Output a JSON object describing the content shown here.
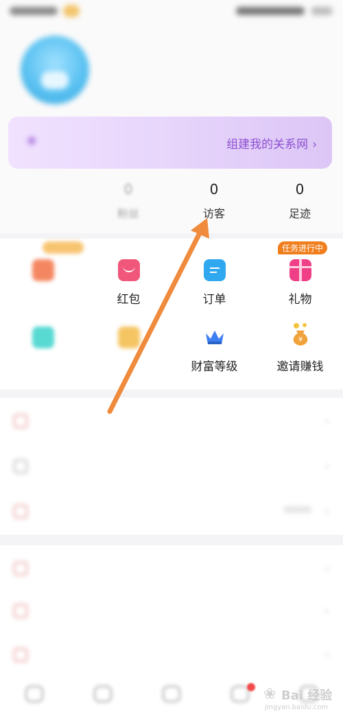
{
  "profile": {
    "username": "",
    "user_id": "",
    "homepage_link": ""
  },
  "banner": {
    "left_text": "",
    "right_link": "组建我的关系网",
    "arrow": "›"
  },
  "stats": [
    {
      "value": "",
      "label": ""
    },
    {
      "value": "0",
      "label": "粉丝"
    },
    {
      "value": "0",
      "label": "访客"
    },
    {
      "value": "0",
      "label": "足迹"
    }
  ],
  "grid": {
    "badges": {
      "task": "任务进行中"
    },
    "items": [
      {
        "label": "",
        "icon": "wallet-icon",
        "color": "#f26a3a"
      },
      {
        "label": "红包",
        "icon": "red-envelope-icon",
        "color": "#f0577a"
      },
      {
        "label": "订单",
        "icon": "order-icon",
        "color": "#2fa8ef"
      },
      {
        "label": "礼物",
        "icon": "gift-icon",
        "color": "#ef3f86"
      },
      {
        "label": "",
        "icon": "heart-icon",
        "color": "#2fd0c8"
      },
      {
        "label": "",
        "icon": "badge-icon",
        "color": "#f3b73d"
      },
      {
        "label": "财富等级",
        "icon": "crown-icon",
        "color": "#3d7ef0"
      },
      {
        "label": "邀请赚钱",
        "icon": "money-bag-icon",
        "color": "#f0a23b"
      }
    ]
  },
  "menu": {
    "group1": [
      {
        "label": "",
        "value": "",
        "chevron": "›"
      },
      {
        "label": "",
        "value": "",
        "chevron": "›"
      },
      {
        "label": "",
        "value": "",
        "chevron": "›"
      }
    ],
    "group2": [
      {
        "label": "",
        "value": "",
        "chevron": "›"
      },
      {
        "label": "",
        "value": "",
        "chevron": "›"
      },
      {
        "label": "",
        "value": "",
        "chevron": "›"
      }
    ]
  },
  "bottom_nav": [
    {
      "label": "",
      "icon": "home-icon"
    },
    {
      "label": "",
      "icon": "discover-icon"
    },
    {
      "label": "",
      "icon": "chat-icon"
    },
    {
      "label": "",
      "icon": "message-icon"
    },
    {
      "label": "",
      "icon": "me-icon"
    }
  ],
  "watermark": {
    "text": "Bai 经验",
    "url": "jingyan.baidu.com"
  },
  "annotation": {
    "arrow_color": "#f08a3c"
  }
}
